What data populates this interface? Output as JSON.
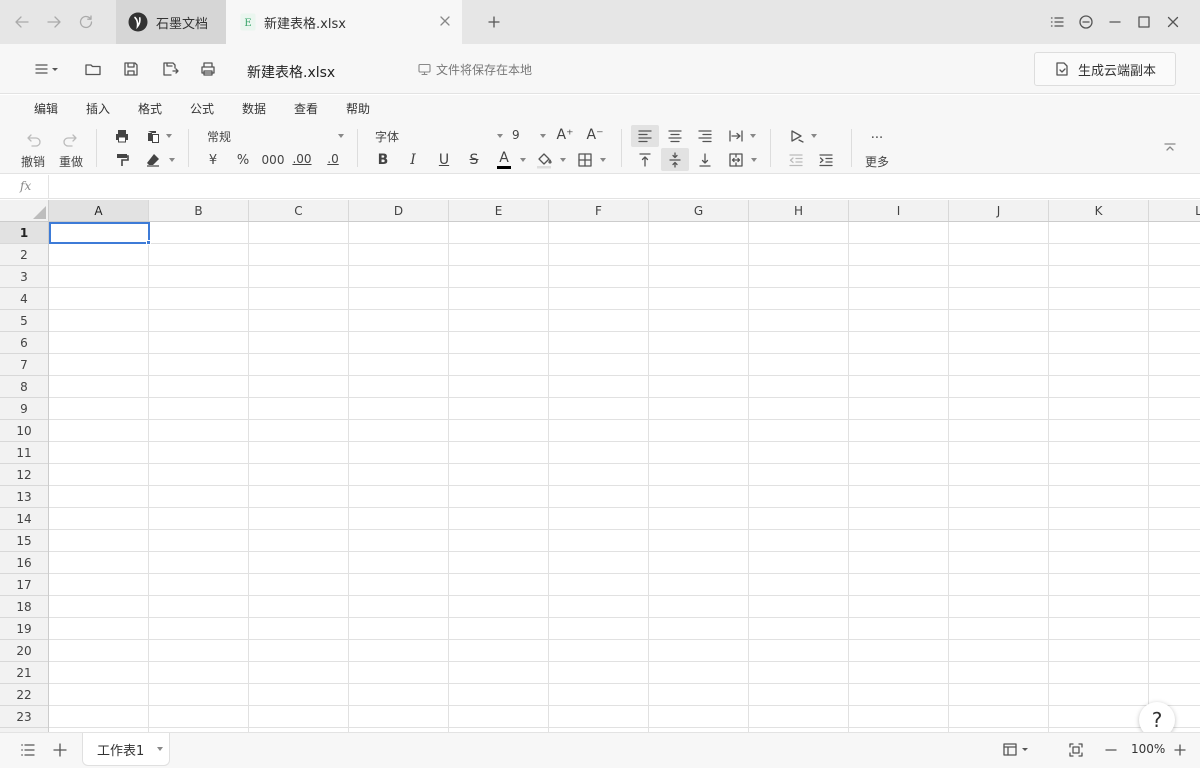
{
  "tabs": [
    {
      "label": "石墨文档",
      "icon": "shimo-logo-icon"
    },
    {
      "label": "新建表格.xlsx",
      "icon": "excel-file-icon",
      "type_letter": "E"
    }
  ],
  "header": {
    "filename": "新建表格.xlsx",
    "save_note": "文件将保存在本地",
    "cloud_button": "生成云端副本"
  },
  "menu": [
    "编辑",
    "插入",
    "格式",
    "公式",
    "数据",
    "查看",
    "帮助"
  ],
  "toolbar": {
    "undo": "撤销",
    "redo": "重做",
    "number_format": "常规",
    "currency": "¥",
    "percent": "%",
    "thousands": "000",
    "decimal_inc": ".00",
    "decimal_dec": ".0",
    "font_name": "字体",
    "font_size": "9",
    "font_inc": "A⁺",
    "font_dec": "A⁻",
    "bold": "B",
    "italic": "I",
    "underline": "U",
    "strike": "S",
    "font_color_letter": "A",
    "more_dots": "...",
    "more": "更多"
  },
  "formula_bar": {
    "label": "fx",
    "value": ""
  },
  "grid": {
    "columns": [
      "A",
      "B",
      "C",
      "D",
      "E",
      "F",
      "G",
      "H",
      "I",
      "J",
      "K",
      "L"
    ],
    "rows": [
      "1",
      "2",
      "3",
      "4",
      "5",
      "6",
      "7",
      "8",
      "9",
      "10",
      "11",
      "12",
      "13",
      "14",
      "15",
      "16",
      "17",
      "18",
      "19",
      "20",
      "21",
      "22",
      "23"
    ],
    "selected_cell": "A1"
  },
  "help": "?",
  "sheet": {
    "tab_label": "工作表1"
  },
  "zoom": {
    "value": "100%"
  },
  "colors": {
    "accent": "#3d7bd7",
    "excel_green": "#3aa56b"
  }
}
